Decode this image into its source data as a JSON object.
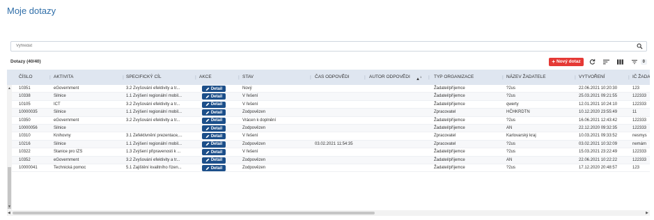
{
  "page": {
    "title": "Moje dotazy"
  },
  "search": {
    "placeholder": "Vyhledat"
  },
  "list": {
    "title": "Dotazy (40/40)"
  },
  "toolbar": {
    "new_label": "Nový dotaz",
    "new_plus": "+",
    "filter_count": "0"
  },
  "columns": [
    "ČÍSLO",
    "AKTIVITA",
    "SPECIFICKÝ CÍL",
    "AKCE",
    "STAV",
    "ČAS ODPOVĚDI",
    "AUTOR ODPOVĚDI",
    "TYP ORGANIZACE",
    "NÁZEV ŽADATELE",
    "VYTVOŘENÍ",
    "IČ ŽADA"
  ],
  "sort_indicator": "1",
  "detail_label": "Detail",
  "rows": [
    [
      "10351",
      "eGovernment",
      "3.2 Zvyšování efektivity a tr...",
      "Nový",
      "",
      "",
      "Žadatel/příjemce",
      "?2us",
      "22.06.2021 10:20:30",
      "123"
    ],
    [
      "10338",
      "Silnice",
      "1.1 Zvýšení regionální mobil...",
      "V řešení",
      "",
      "",
      "Žadatel/příjemce",
      "?2us",
      "25.03.2021 09:21:55",
      "122333"
    ],
    [
      "10105",
      "ICT",
      "3.2 Zvyšování efektivity a tr...",
      "V řešení",
      "",
      "",
      "Žadatel/příjemce",
      "qwerty",
      "12.01.2021 10:24:10",
      "122333"
    ],
    [
      "10000035",
      "Silnice",
      "1.1 Zvýšení regionální mobil...",
      "Zodpovězen",
      "",
      "",
      "Zpracovatel",
      "HČHKRDTN",
      "10.12.2020 23:55:49",
      "11"
    ],
    [
      "10350",
      "eGovernment",
      "3.2 Zvyšování efektivity a tr...",
      "Vrácen k doplnění",
      "",
      "",
      "Žadatel/příjemce",
      "?2us",
      "16.06.2021 12:43:42",
      "122333"
    ],
    [
      "10000056",
      "Silnice",
      "",
      "Zodpovězen",
      "",
      "",
      "Žadatel/příjemce",
      "AN",
      "22.12.2020 09:32:35",
      "122333"
    ],
    [
      "10310",
      "Knihovny",
      "3.1 Zefektivnění prezentace,...",
      "V řešení",
      "",
      "",
      "Zpracovatel",
      "Karlovarský kraj",
      "10.03.2021 09:33:52",
      "nesmys"
    ],
    [
      "10216",
      "Silnice",
      "1.1 Zvýšení regionální mobil...",
      "Zodpovězen",
      "03.02.2021 11:54:35",
      "",
      "Zpracovatel",
      "?2us",
      "03.02.2021 10:32:09",
      "nemám"
    ],
    [
      "10322",
      "Stanice pro IZS",
      "1.3 Zvýšení připravenosti k ...",
      "V řešení",
      "",
      "",
      "Žadatel/příjemce",
      "?2us",
      "15.03.2021 23:22:49",
      "122333"
    ],
    [
      "10352",
      "eGovernment",
      "3.2 Zvyšování efektivity a tr...",
      "Zodpovězen",
      "",
      "",
      "Žadatel/příjemce",
      "AN",
      "22.06.2021 10:22:22",
      "122333"
    ],
    [
      "10000041",
      "Technická pomoc",
      "5.1 Zajištění kvalitního řízen...",
      "Zodpovězen",
      "",
      "",
      "Žadatel/příjemce",
      "?2us",
      "17.12.2020 20:48:57",
      "123"
    ]
  ]
}
